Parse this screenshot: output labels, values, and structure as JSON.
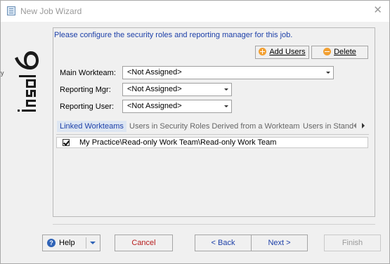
{
  "window": {
    "title": "New Job Wizard",
    "close_glyph": "✕",
    "stray_text": "y"
  },
  "logo": {
    "text": "insol6",
    "accent": "#1a1a1a"
  },
  "instruction": "Please configure the security roles and reporting manager for this job.",
  "toolbar": {
    "add_users": "Add Users",
    "delete": "Delete"
  },
  "form": {
    "main_workteam": {
      "label": "Main Workteam:",
      "value": "<Not Assigned>"
    },
    "reporting_mgr": {
      "label": "Reporting Mgr:",
      "value": "<Not Assigned>"
    },
    "reporting_user": {
      "label": "Reporting User:",
      "value": "<Not Assigned>"
    }
  },
  "tabs": [
    {
      "label": "Linked Workteams",
      "active": true
    },
    {
      "label": "Users in Security Roles Derived from a Workteam",
      "active": false
    },
    {
      "label": "Users in Stand",
      "active": false
    }
  ],
  "list": {
    "rows": [
      {
        "checked": true,
        "text": "My Practice\\Read-only Work Team\\Read-only Work Team"
      }
    ]
  },
  "footer": {
    "help": "Help",
    "cancel": "Cancel",
    "back": "< Back",
    "next": "Next >",
    "finish": "Finish"
  },
  "colors": {
    "accent_blue": "#1c3fa8",
    "cancel_red": "#b71c1c",
    "icon_orange": "#f29f30",
    "disabled_gray": "#9a9a9a"
  }
}
